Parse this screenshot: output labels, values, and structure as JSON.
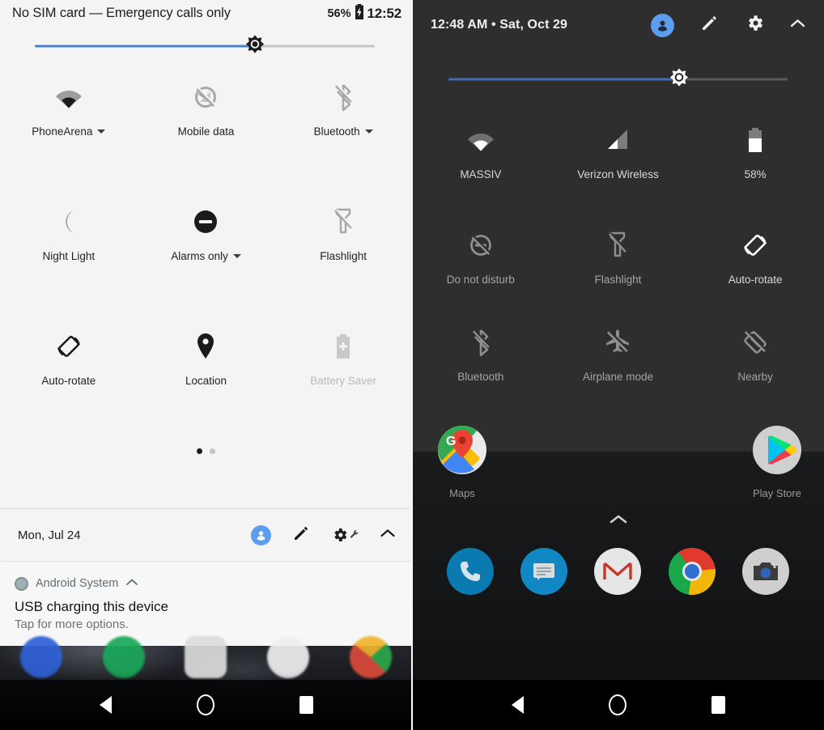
{
  "left_panel": {
    "status_bar": {
      "carrier_text": "No SIM card — Emergency calls only",
      "battery_percent": "56%",
      "battery_icon": "battery-charging-icon",
      "clock": "12:52"
    },
    "brightness_slider": {
      "icon": "brightness-icon",
      "value_percent": 65
    },
    "tiles": [
      {
        "label": "PhoneArena",
        "icon": "wifi-icon",
        "enabled": true,
        "has_dropdown": true
      },
      {
        "label": "Mobile data",
        "icon": "mobile-data-off-icon",
        "enabled": false,
        "has_dropdown": false
      },
      {
        "label": "Bluetooth",
        "icon": "bluetooth-off-icon",
        "enabled": false,
        "has_dropdown": true
      },
      {
        "label": "Night Light",
        "icon": "moon-icon",
        "enabled": false,
        "has_dropdown": false
      },
      {
        "label": "Alarms only",
        "icon": "do-not-disturb-icon",
        "enabled": true,
        "has_dropdown": true
      },
      {
        "label": "Flashlight",
        "icon": "flashlight-off-icon",
        "enabled": false,
        "has_dropdown": false
      },
      {
        "label": "Auto-rotate",
        "icon": "auto-rotate-icon",
        "enabled": true,
        "has_dropdown": false
      },
      {
        "label": "Location",
        "icon": "location-pin-icon",
        "enabled": true,
        "has_dropdown": false
      },
      {
        "label": "Battery Saver",
        "icon": "battery-saver-icon",
        "enabled": false,
        "has_dropdown": false
      }
    ],
    "page_indicator": {
      "pages": 2,
      "active": 1
    },
    "footer": {
      "date": "Mon, Jul 24",
      "icons": [
        "user-avatar-icon",
        "edit-pencil-icon",
        "settings-gear-wrench-icon",
        "collapse-chevron-up-icon"
      ]
    },
    "notification": {
      "app_name": "Android System",
      "expand_icon": "chevron-up-icon",
      "title": "USB charging this device",
      "subtitle": "Tap for more options."
    },
    "nav_bar": {
      "back": "back-triangle-icon",
      "home": "home-circle-icon",
      "recents": "recents-square-icon"
    }
  },
  "right_panel": {
    "header": {
      "clock_date": "12:48 AM • Sat, Oct 29",
      "icons": [
        "user-avatar-icon",
        "edit-pencil-icon",
        "settings-gear-icon",
        "collapse-chevron-up-icon"
      ]
    },
    "brightness_slider": {
      "icon": "brightness-icon",
      "value_percent": 68
    },
    "tiles": [
      {
        "label": "MASSIV",
        "icon": "wifi-icon",
        "enabled": true,
        "has_dropdown": false
      },
      {
        "label": "Verizon Wireless",
        "icon": "signal-bars-icon",
        "enabled": true,
        "has_dropdown": false
      },
      {
        "label": "58%",
        "icon": "battery-icon",
        "enabled": true,
        "has_dropdown": false
      },
      {
        "label": "Do not disturb",
        "icon": "do-not-disturb-off-icon",
        "enabled": false,
        "has_dropdown": false
      },
      {
        "label": "Flashlight",
        "icon": "flashlight-off-icon",
        "enabled": false,
        "has_dropdown": false
      },
      {
        "label": "Auto-rotate",
        "icon": "auto-rotate-icon",
        "enabled": true,
        "has_dropdown": false
      },
      {
        "label": "Bluetooth",
        "icon": "bluetooth-off-icon",
        "enabled": false,
        "has_dropdown": false
      },
      {
        "label": "Airplane mode",
        "icon": "airplane-off-icon",
        "enabled": false,
        "has_dropdown": false
      },
      {
        "label": "Nearby",
        "icon": "nearby-off-icon",
        "enabled": false,
        "has_dropdown": false
      }
    ],
    "home_screen": {
      "apps": [
        {
          "label": "Maps",
          "icon": "google-maps-icon"
        },
        {
          "label": "Play Store",
          "icon": "google-play-icon"
        }
      ],
      "app_drawer_handle": "chevron-up-icon",
      "dock": [
        {
          "icon": "phone-icon"
        },
        {
          "icon": "messages-icon"
        },
        {
          "icon": "gmail-icon"
        },
        {
          "icon": "chrome-icon"
        },
        {
          "icon": "camera-icon"
        }
      ]
    },
    "nav_bar": {
      "back": "back-triangle-icon",
      "home": "home-circle-icon",
      "recents": "recents-square-icon"
    }
  },
  "colors": {
    "left_background": "#f4f4f4",
    "right_background": "#2e2e2e",
    "accent_blue": "#4285c8",
    "avatar_blue": "#5c9ded",
    "disabled_gray": "#b9b9b9"
  }
}
